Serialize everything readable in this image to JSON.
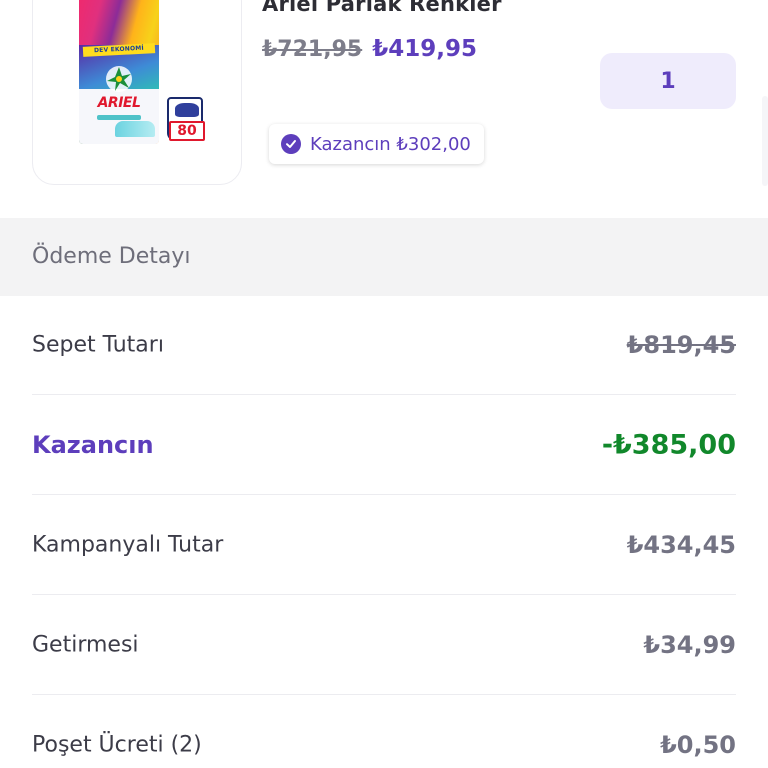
{
  "product": {
    "name": "Ariel Parlak Renkler",
    "old_price": "₺721,95",
    "new_price": "₺419,95",
    "quantity": "1",
    "savings_text": "Kazancın ₺302,00",
    "image": {
      "banner_text": "DEV EKONOMİ",
      "brand_text": "ARIEL",
      "washes_count": "80"
    }
  },
  "payment_details": {
    "title": "Ödeme Detayı",
    "rows": [
      {
        "label": "Sepet Tutarı",
        "value": "₺819,45"
      },
      {
        "label": "Kazancın",
        "value": "-₺385,00"
      },
      {
        "label": "Kampanyalı Tutar",
        "value": "₺434,45"
      },
      {
        "label": "Getirmesi",
        "value": "₺34,99"
      },
      {
        "label": "Poşet Ücreti (2)",
        "value": "₺0,50"
      }
    ]
  },
  "colors": {
    "accent": "#5d3ebc",
    "positive": "#11882b",
    "muted": "#737383",
    "section_bg": "#f3f3f4"
  }
}
